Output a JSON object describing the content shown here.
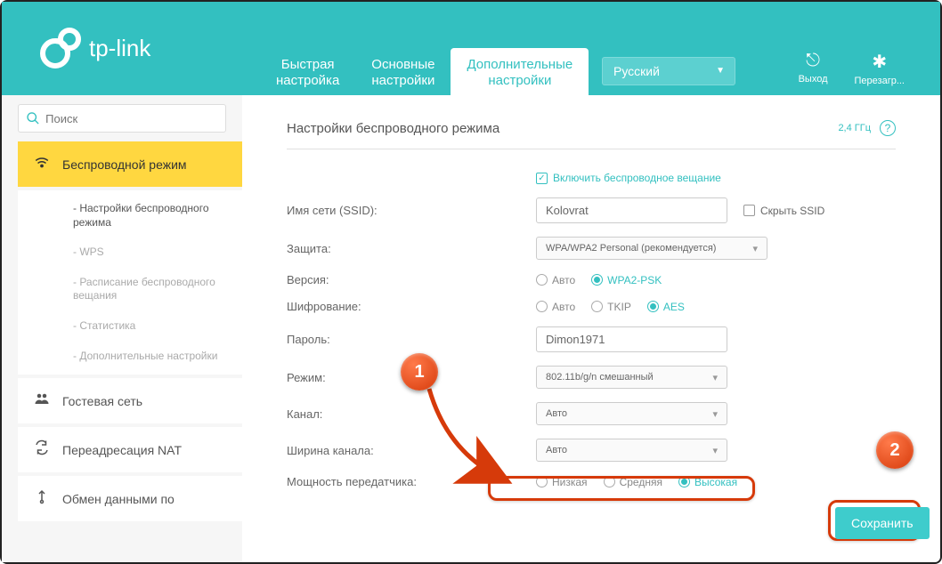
{
  "brand": "tp-link",
  "nav": {
    "quick": "Быстрая\nнастройка",
    "basic": "Основные\nнастройки",
    "advanced": "Дополнительные\nнастройки"
  },
  "language": "Русский",
  "header_actions": {
    "logout": "Выход",
    "reboot": "Перезагр..."
  },
  "search_placeholder": "Поиск",
  "sidebar": {
    "wireless": "Беспроводной режим",
    "sub": {
      "wireless_settings": "- Настройки беспроводного режима",
      "wps": "- WPS",
      "schedule": "- Расписание беспроводного вещания",
      "statistics": "- Статистика",
      "advanced": "- Дополнительные настройки"
    },
    "guest": "Гостевая сеть",
    "nat": "Переадресация NAT",
    "data": "Обмен данными по"
  },
  "content": {
    "title": "Настройки беспроводного режима",
    "band": "2,4 ГГц",
    "enable_radio": "Включить беспроводное вещание",
    "labels": {
      "ssid": "Имя сети (SSID):",
      "security": "Защита:",
      "version": "Версия:",
      "encryption": "Шифрование:",
      "password": "Пароль:",
      "mode": "Режим:",
      "channel": "Канал:",
      "width": "Ширина канала:",
      "power": "Мощность передатчика:"
    },
    "values": {
      "ssid": "Kolovrat",
      "hide_ssid": "Скрыть SSID",
      "security": "WPA/WPA2 Personal (рекомендуется)",
      "version": {
        "auto": "Авто",
        "wpa2": "WPA2-PSK"
      },
      "encryption": {
        "auto": "Авто",
        "tkip": "TKIP",
        "aes": "AES"
      },
      "password": "Dimon1971",
      "mode": "802.11b/g/n смешанный",
      "channel": "Авто",
      "width": "Авто",
      "power": {
        "low": "Низкая",
        "medium": "Средняя",
        "high": "Высокая"
      }
    },
    "save": "Сохранить"
  },
  "annotations": {
    "step1": "1",
    "step2": "2"
  }
}
